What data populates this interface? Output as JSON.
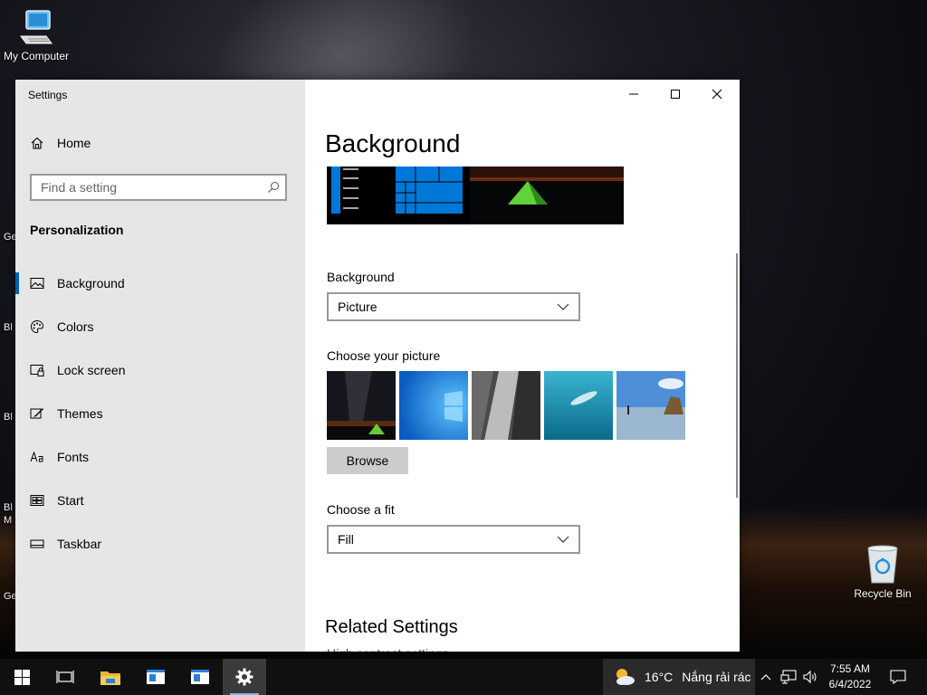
{
  "desktop": {
    "my_computer_label": "My Computer",
    "recycle_bin_label": "Recycle Bin",
    "left_fragments": [
      "Ge",
      "Bl",
      "Bl",
      "Bl",
      "M",
      "Ge"
    ]
  },
  "window": {
    "title": "Settings",
    "home_label": "Home",
    "search_placeholder": "Find a setting",
    "section_title": "Personalization",
    "nav_items": [
      {
        "label": "Background",
        "icon": "picture-icon",
        "active": true
      },
      {
        "label": "Colors",
        "icon": "palette-icon",
        "active": false
      },
      {
        "label": "Lock screen",
        "icon": "lock-screen-icon",
        "active": false
      },
      {
        "label": "Themes",
        "icon": "themes-icon",
        "active": false
      },
      {
        "label": "Fonts",
        "icon": "fonts-icon",
        "active": false
      },
      {
        "label": "Start",
        "icon": "start-icon",
        "active": false
      },
      {
        "label": "Taskbar",
        "icon": "taskbar-icon",
        "active": false
      }
    ]
  },
  "content": {
    "page_title": "Background",
    "background_label": "Background",
    "background_value": "Picture",
    "choose_picture_label": "Choose your picture",
    "browse_label": "Browse",
    "choose_fit_label": "Choose a fit",
    "fit_value": "Fill",
    "related_title": "Related Settings",
    "related_partial": "High contrast settings"
  },
  "taskbar": {
    "weather_temp": "16°C",
    "weather_desc": "Nắng rải rác",
    "time": "7:55 AM",
    "date": "6/4/2022"
  },
  "colors": {
    "accent": "#0078d7",
    "active_indicator": "#0063b1",
    "sidebar_bg": "#e6e6e6",
    "taskbar_bg": "#101010"
  }
}
